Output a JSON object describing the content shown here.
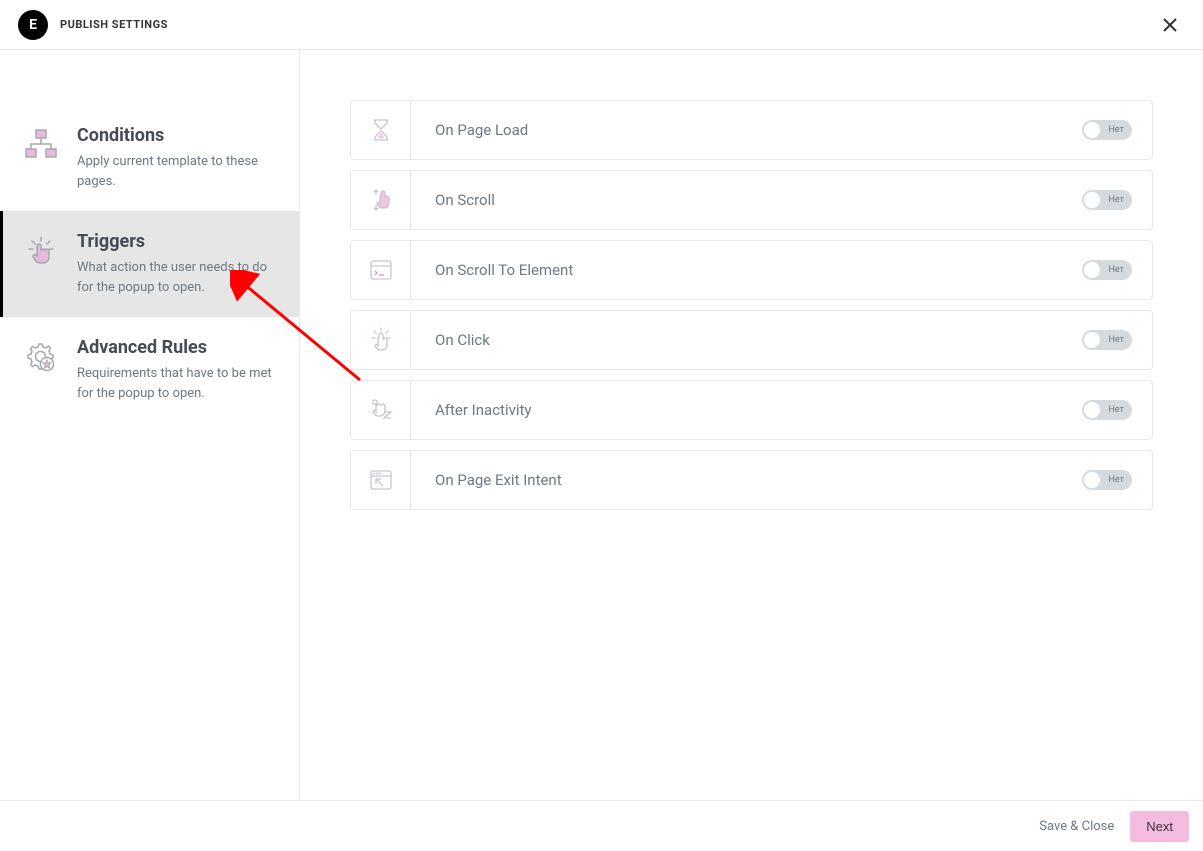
{
  "header": {
    "logo_text": "E",
    "title": "PUBLISH SETTINGS"
  },
  "sidebar": {
    "items": [
      {
        "title": "Conditions",
        "desc": "Apply current template to these pages."
      },
      {
        "title": "Triggers",
        "desc": "What action the user needs to do for the popup to open."
      },
      {
        "title": "Advanced Rules",
        "desc": "Requirements that have to be met for the popup to open."
      }
    ]
  },
  "triggers": [
    {
      "label": "On Page Load",
      "toggle": "Нет"
    },
    {
      "label": "On Scroll",
      "toggle": "Нет"
    },
    {
      "label": "On Scroll To Element",
      "toggle": "Нет"
    },
    {
      "label": "On Click",
      "toggle": "Нет"
    },
    {
      "label": "After Inactivity",
      "toggle": "Нет"
    },
    {
      "label": "On Page Exit Intent",
      "toggle": "Нет"
    }
  ],
  "footer": {
    "save_close": "Save & Close",
    "next": "Next"
  }
}
